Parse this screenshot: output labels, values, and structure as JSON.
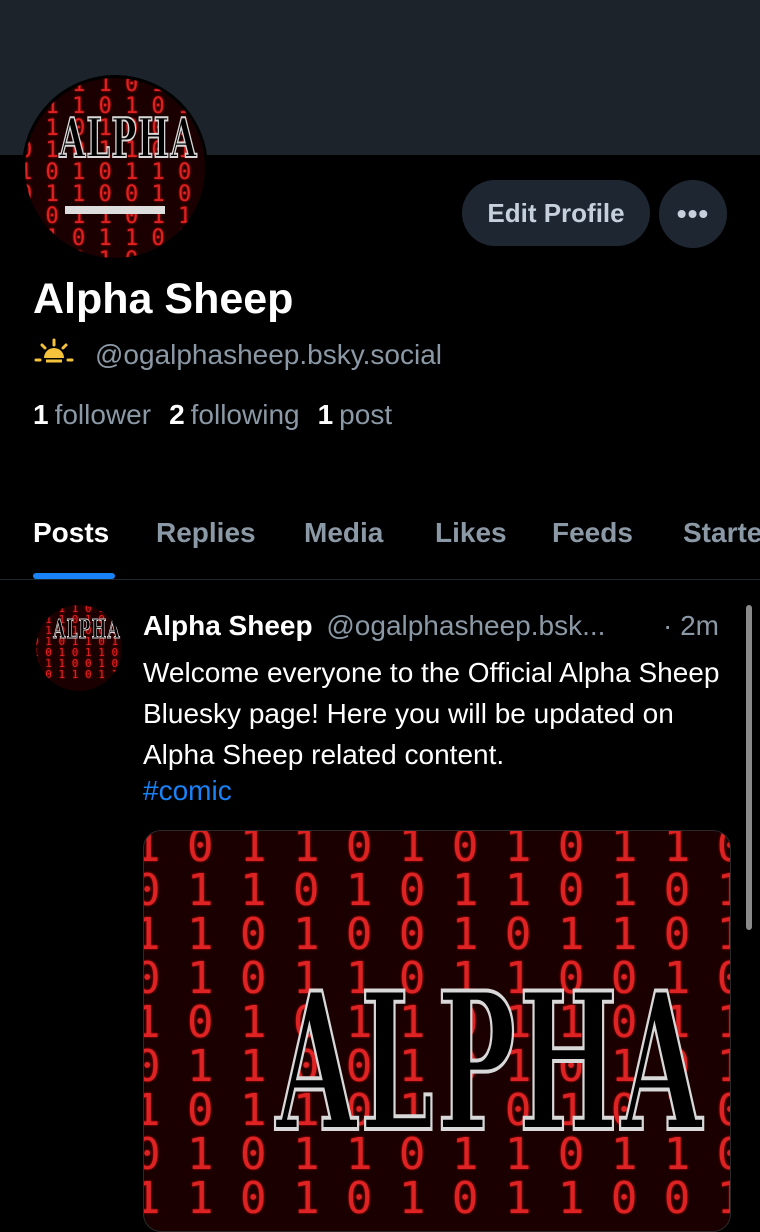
{
  "profile": {
    "name": "Alpha Sheep",
    "handle": "@ogalphasheep.bsky.social",
    "followers_count": "1",
    "followers_label": "follower",
    "following_count": "2",
    "following_label": "following",
    "posts_count": "1",
    "posts_label": "post",
    "avatar_text": "ALPHA"
  },
  "actions": {
    "edit_label": "Edit Profile",
    "more_label": "•••"
  },
  "tabs": [
    {
      "label": "Posts",
      "active": true
    },
    {
      "label": "Replies",
      "active": false
    },
    {
      "label": "Media",
      "active": false
    },
    {
      "label": "Likes",
      "active": false
    },
    {
      "label": "Feeds",
      "active": false
    },
    {
      "label": "Starte",
      "active": false
    }
  ],
  "post": {
    "author_name": "Alpha Sheep",
    "author_handle": "@ogalphasheep.bsk...",
    "time": "· 2m",
    "text": "Welcome everyone to the Official Alpha Sheep Bluesky page! Here you will be updated on Alpha Sheep related content.",
    "hashtag": "#comic",
    "image_text": "ALPHA"
  },
  "colors": {
    "accent": "#1a82f7",
    "muted": "#8b98a5",
    "banner": "#1d232a",
    "button_bg": "#1e2731"
  },
  "icons": {
    "handle_badge": "sun-icon",
    "more": "ellipsis-icon"
  }
}
